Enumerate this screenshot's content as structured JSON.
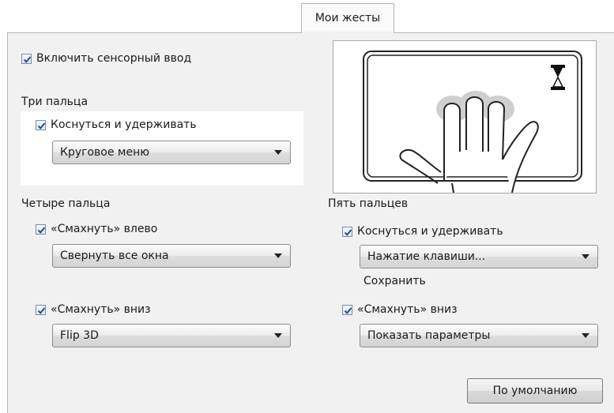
{
  "tab": {
    "label": "Мои жесты"
  },
  "enable_touch": {
    "label": "Включить сенсорный ввод",
    "checked": true
  },
  "three_fingers": {
    "heading": "Три пальца",
    "touch_hold": {
      "label": "Коснуться и удерживать",
      "checked": true
    },
    "action": {
      "value": "Круговое меню"
    }
  },
  "four_fingers": {
    "heading": "Четыре пальца",
    "swipe_left": {
      "label": "«Смахнуть» влево",
      "checked": true
    },
    "swipe_left_action": {
      "value": "Свернуть все окна"
    },
    "swipe_down": {
      "label": "«Смахнуть» вниз",
      "checked": true
    },
    "swipe_down_action": {
      "value": "Flip 3D"
    }
  },
  "five_fingers": {
    "heading": "Пять пальцев",
    "touch_hold": {
      "label": "Коснуться и удерживать",
      "checked": true
    },
    "touch_hold_action": {
      "value": "Нажатие клавиши..."
    },
    "save_link": "Сохранить",
    "swipe_down": {
      "label": "«Смахнуть» вниз",
      "checked": true
    },
    "swipe_down_action": {
      "value": "Показать параметры"
    }
  },
  "defaults_button": {
    "label": "По умолчанию"
  },
  "icons": {
    "checkbox": "checkmark-icon",
    "dropdown": "chevron-down-icon",
    "preview": "hand-gesture-illustration",
    "wait": "hourglass-icon"
  },
  "colors": {
    "panel": "#f1f1f1",
    "checkbox_border": "#6f8fb8",
    "checkmark": "#2a4f7a"
  }
}
